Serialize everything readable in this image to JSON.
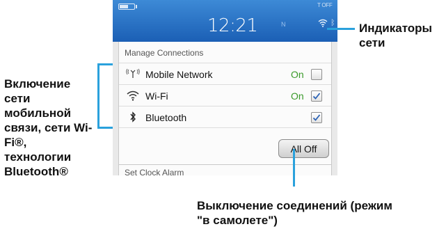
{
  "status_bar": {
    "time": "12:21",
    "network_indicator": "N",
    "top_right_indicator": "T OFF"
  },
  "manage_connections": {
    "title": "Manage Connections",
    "rows": [
      {
        "icon": "mobile-network-icon",
        "label": "Mobile Network",
        "state": "On",
        "checked": false
      },
      {
        "icon": "wifi-icon",
        "label": "Wi-Fi",
        "state": "On",
        "checked": true
      },
      {
        "icon": "bluetooth-icon",
        "label": "Bluetooth",
        "state": "",
        "checked": true
      }
    ],
    "all_off_label": "All Off"
  },
  "next_section": {
    "title": "Set Clock Alarm"
  },
  "callouts": {
    "network_indicators": "Индикаторы сети",
    "enable_connections": "Включение сети мобильной связи, сети Wi-Fi®, технологии Bluetooth®",
    "disable_connections": "Выключение соединений (режим \"в самолете\")"
  },
  "colors": {
    "status_bar": "#1b5fb5",
    "callout_line": "#2aa1dc",
    "on_state": "#3a9a2a"
  }
}
